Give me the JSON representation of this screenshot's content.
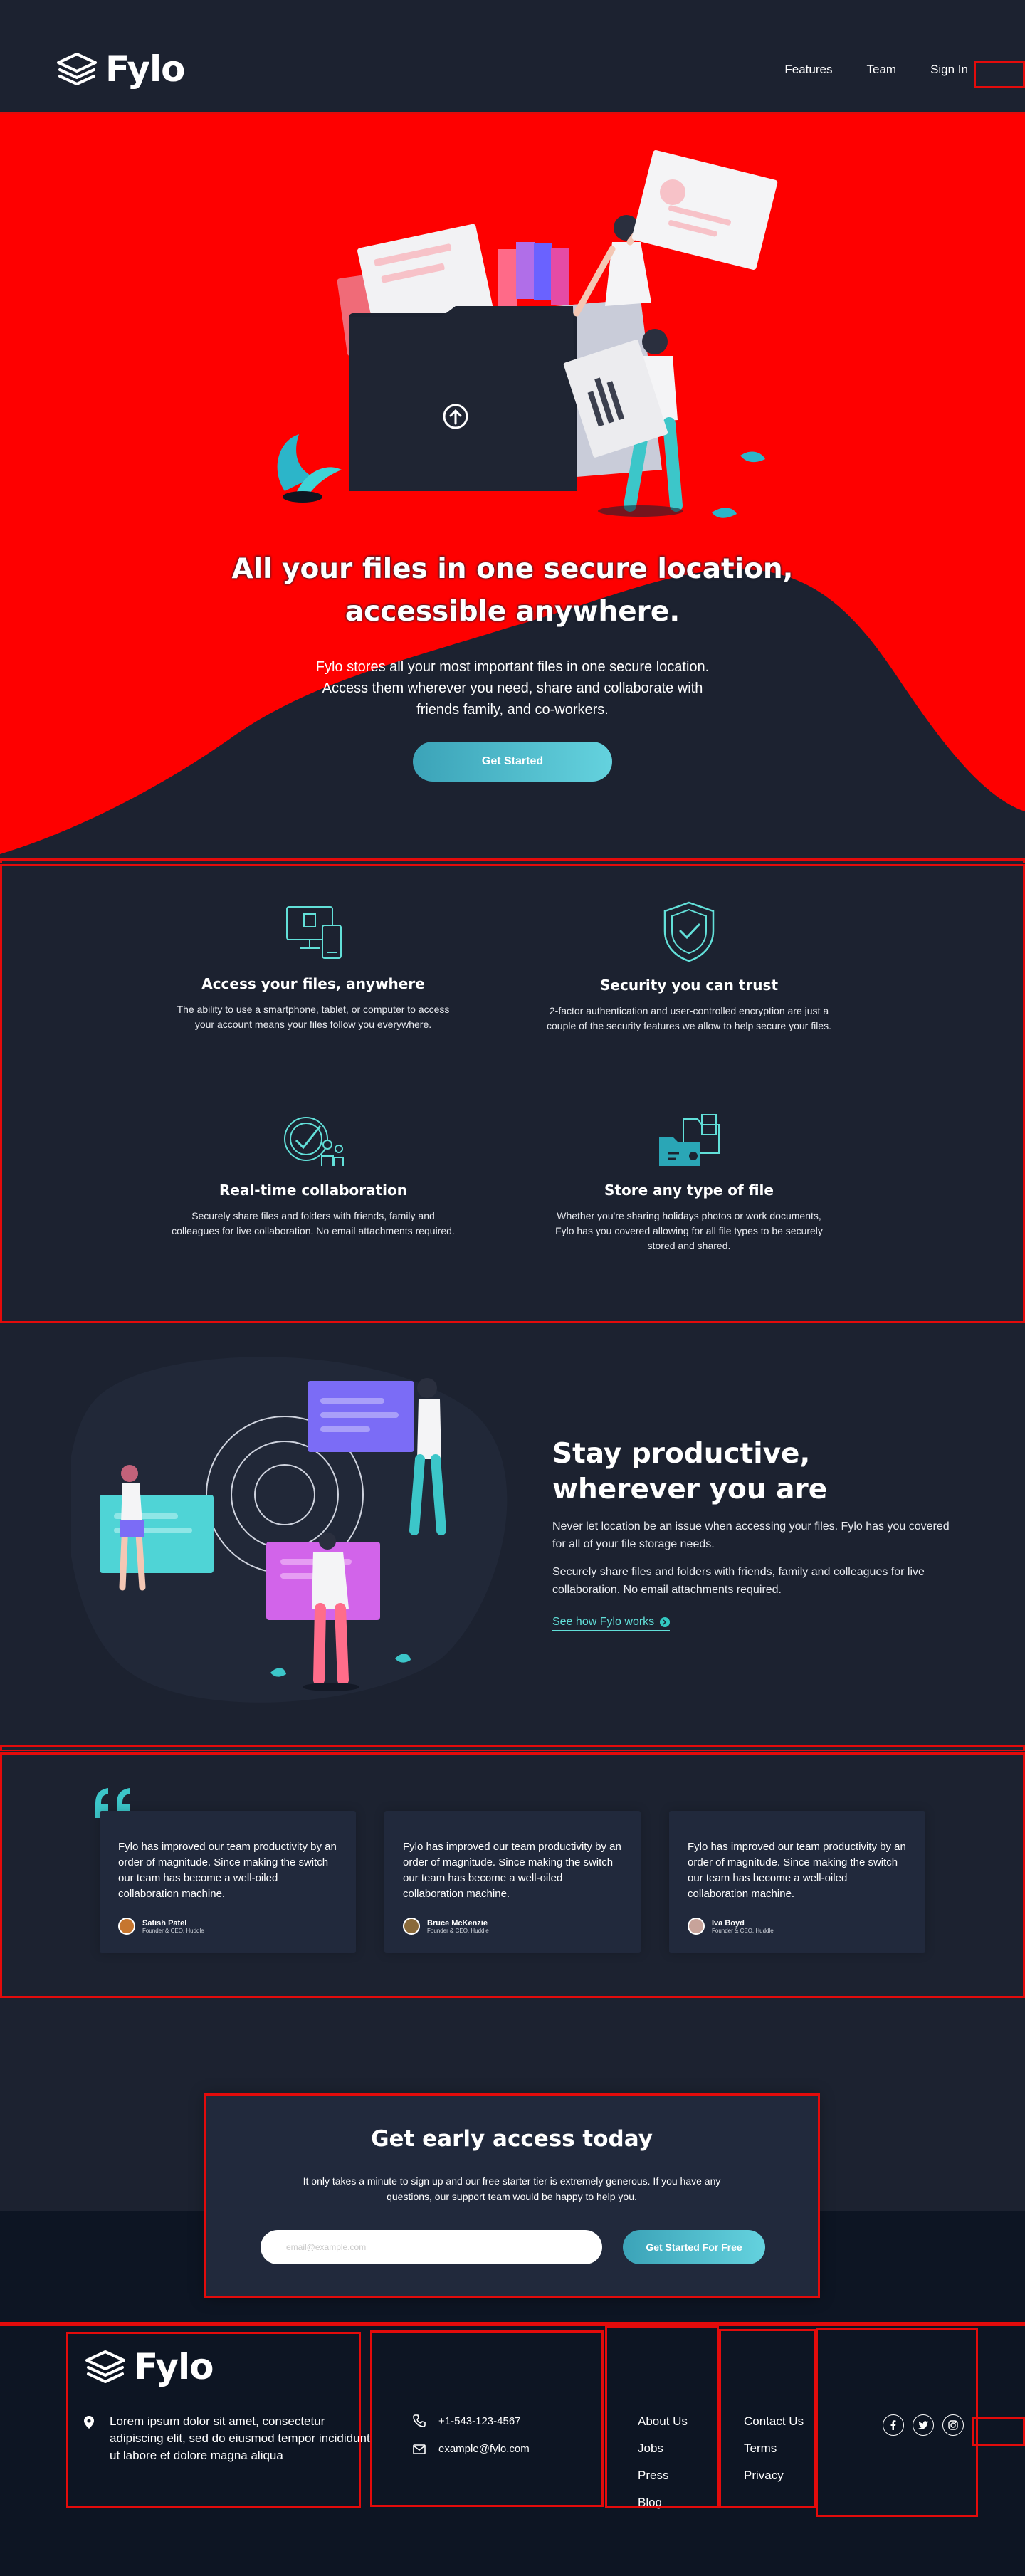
{
  "nav": {
    "logo_text": "Fylo",
    "links": [
      "Features",
      "Team",
      "Sign In"
    ]
  },
  "hero": {
    "title_line1": "All your files in one secure location,",
    "title_line2": "accessible anywhere.",
    "text": "Fylo stores all your most important files in one secure location. Access them wherever you need, share and collaborate with friends family, and co-workers.",
    "cta_label": "Get Started"
  },
  "features": [
    {
      "icon": "access-anywhere-icon",
      "title": "Access your files, anywhere",
      "desc": "The ability to use a smartphone, tablet, or computer to access your account means your files follow you everywhere."
    },
    {
      "icon": "security-shield-icon",
      "title": "Security you can trust",
      "desc": "2-factor authentication and user-controlled encryption are just a couple of the security features we allow to help secure your files."
    },
    {
      "icon": "collaboration-icon",
      "title": "Real-time collaboration",
      "desc": "Securely share files and folders with friends, family and colleagues for live collaboration. No email attachments required."
    },
    {
      "icon": "file-storage-icon",
      "title": "Store any type of file",
      "desc": "Whether you're sharing holidays photos or work documents, Fylo has you covered allowing for all file types to be securely stored and shared."
    }
  ],
  "productive": {
    "title_line1": "Stay productive,",
    "title_line2": "wherever you are",
    "p1": "Never let location be an issue when accessing your files. Fylo has you covered for all of your file storage needs.",
    "p2": "Securely share files and folders with friends, family and colleagues for live collaboration. No email attachments required.",
    "link_label": "See how Fylo works"
  },
  "testimonials": [
    {
      "quote": "Fylo has improved our team productivity by an order of magnitude. Since making the switch our team has become a well-oiled collaboration machine.",
      "name": "Satish Patel",
      "role": "Founder & CEO, Huddle",
      "avatar_color": "#c6762f"
    },
    {
      "quote": "Fylo has improved our team productivity by an order of magnitude. Since making the switch our team has become a well-oiled collaboration machine.",
      "name": "Bruce McKenzie",
      "role": "Founder & CEO, Huddle",
      "avatar_color": "#8a6a3a"
    },
    {
      "quote": "Fylo has improved our team productivity by an order of magnitude. Since making the switch our team has become a well-oiled collaboration machine.",
      "name": "Iva Boyd",
      "role": "Founder & CEO, Huddle",
      "avatar_color": "#c7a39a"
    }
  ],
  "early_access": {
    "title": "Get early access today",
    "text": "It only takes a minute to sign up and our free starter tier is extremely generous. If you have any questions, our support team would be happy to help you.",
    "email_placeholder": "email@example.com",
    "button_label": "Get Started For Free"
  },
  "footer": {
    "logo_text": "Fylo",
    "address": "Lorem ipsum dolor sit amet, consectetur adipiscing elit, sed do eiusmod tempor incididunt ut labore et dolore magna aliqua",
    "phone": "+1-543-123-4567",
    "email": "example@fylo.com",
    "col1": [
      "About Us",
      "Jobs",
      "Press",
      "Blog"
    ],
    "col2": [
      "Contact Us",
      "Terms",
      "Privacy"
    ],
    "socials": [
      "facebook-icon",
      "twitter-icon",
      "instagram-icon"
    ]
  },
  "colors": {
    "background": "#1c2230",
    "hero_background": "#fe0000",
    "card": "#21293c",
    "footer": "#0d1523",
    "accent": "#62e0d9",
    "button_start": "#3ba3b8",
    "button_end": "#64d2de"
  }
}
